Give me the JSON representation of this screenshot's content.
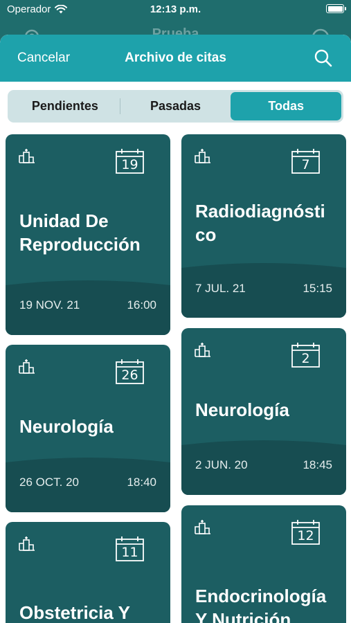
{
  "status_bar": {
    "carrier": "Operador",
    "time": "12:13 p.m."
  },
  "back_header": {
    "title": "Prueba"
  },
  "nav": {
    "cancel_label": "Cancelar",
    "title": "Archivo de citas"
  },
  "segments": [
    {
      "label": "Pendientes",
      "active": false
    },
    {
      "label": "Pasadas",
      "active": false
    },
    {
      "label": "Todas",
      "active": true
    }
  ],
  "appointments": [
    {
      "day": "19",
      "title_line1": "Unidad De",
      "title_line2": "Reproducción",
      "date": "19 NOV. 21",
      "time": "16:00"
    },
    {
      "day": "7",
      "title_line1": "Radiodiagnósti",
      "title_line2": "co",
      "date": "7 JUL. 21",
      "time": "15:15"
    },
    {
      "day": "26",
      "title_line1": "Neurología",
      "title_line2": "",
      "date": "26 OCT. 20",
      "time": "18:40"
    },
    {
      "day": "2",
      "title_line1": "Neurología",
      "title_line2": "",
      "date": "2 JUN. 20",
      "time": "18:45"
    },
    {
      "day": "11",
      "title_line1": "Obstetricia Y",
      "title_line2": "",
      "date": "",
      "time": ""
    },
    {
      "day": "12",
      "title_line1": "Endocrinología",
      "title_line2": "Y Nutrición",
      "date": "",
      "time": ""
    }
  ],
  "colors": {
    "accent": "#1ea2ab",
    "card": "#1c5e62",
    "card_dark": "#174d51",
    "segment_bg": "#cfe2e4"
  },
  "icons": [
    "wifi-icon",
    "battery-icon",
    "gear-icon",
    "search-icon",
    "hospital-icon",
    "calendar-icon"
  ]
}
